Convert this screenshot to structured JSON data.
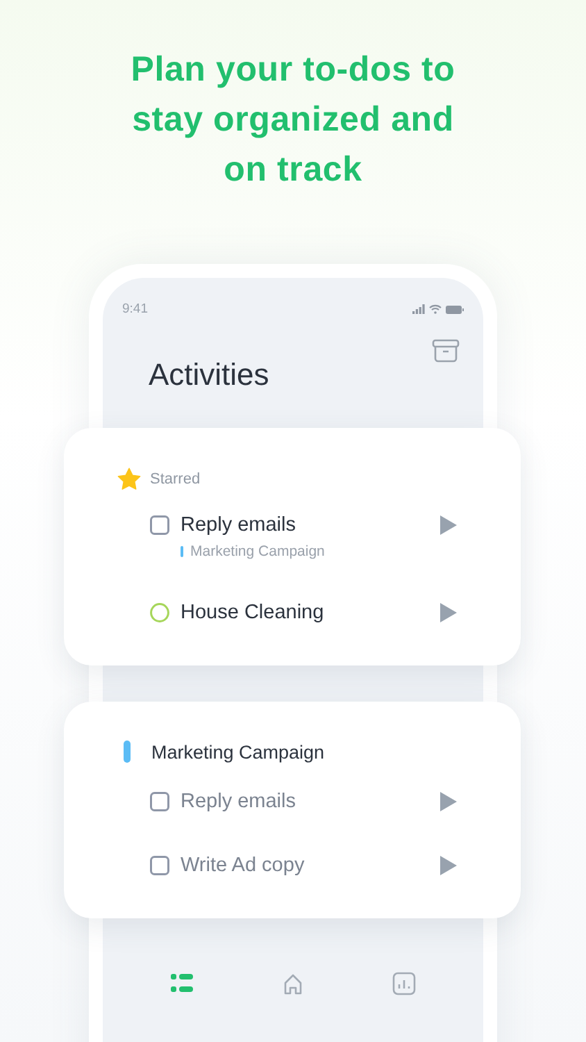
{
  "headline": "Plan your to-dos to stay organized and on track",
  "status_bar": {
    "time": "9:41"
  },
  "title": "Activities",
  "sections": [
    {
      "kind": "starred",
      "header": "Starred",
      "tasks": [
        {
          "kind": "checkbox",
          "title": "Reply emails",
          "checked": false,
          "project": {
            "name": "Marketing Campaign",
            "color": "#5bbcf5"
          }
        },
        {
          "kind": "habit",
          "title": "House Cleaning",
          "checked": false
        }
      ]
    },
    {
      "kind": "project",
      "header": "Marketing Campaign",
      "color": "#5bbcf5",
      "tasks": [
        {
          "kind": "checkbox",
          "title": "Reply emails",
          "checked": false
        },
        {
          "kind": "checkbox",
          "title": "Write Ad copy",
          "checked": false
        }
      ]
    }
  ],
  "nav": [
    {
      "kind": "list",
      "selected": true
    },
    {
      "kind": "home",
      "selected": false
    },
    {
      "kind": "stats",
      "selected": false
    }
  ]
}
